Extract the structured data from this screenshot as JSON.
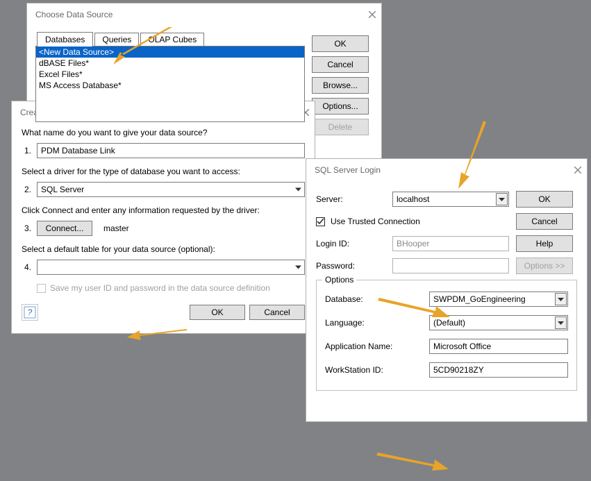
{
  "cds": {
    "title": "Choose Data Source",
    "tabs": [
      "Databases",
      "Queries",
      "OLAP Cubes"
    ],
    "list_items": [
      "<New Data Source>",
      "dBASE Files*",
      "Excel Files*",
      "MS Access Database*"
    ],
    "buttons": {
      "ok": "OK",
      "cancel": "Cancel",
      "browse": "Browse...",
      "options": "Options...",
      "delete": "Delete"
    }
  },
  "cnds": {
    "title": "Create New Data Source",
    "q1": "What name do you want to give your data source?",
    "q2": "Select a driver for the type of database you want to access:",
    "q3": "Click Connect and enter any information requested by the driver:",
    "q4": "Select a default table for your data source (optional):",
    "row_nums": {
      "1": "1.",
      "2": "2.",
      "3": "3.",
      "4": "4."
    },
    "name_value": "PDM Database Link",
    "driver_value": "SQL Server",
    "connect_label": "Connect...",
    "connected_db": "master",
    "save_creds_label": "Save my user ID and password in the data source definition",
    "help_glyph": "❓",
    "ok": "OK",
    "cancel": "Cancel"
  },
  "sql": {
    "title": "SQL Server Login",
    "labels": {
      "server": "Server:",
      "trusted": "Use Trusted Connection",
      "login": "Login ID:",
      "password": "Password:",
      "options_legend": "Options",
      "database": "Database:",
      "language": "Language:",
      "appname": "Application Name:",
      "workstation": "WorkStation ID:"
    },
    "values": {
      "server": "localhost",
      "login": "BHooper",
      "password": "",
      "database": "SWPDM_GoEngineering",
      "language": "(Default)",
      "appname": "Microsoft Office",
      "workstation": "5CD90218ZY"
    },
    "buttons": {
      "ok": "OK",
      "cancel": "Cancel",
      "help": "Help",
      "options": "Options >>"
    }
  }
}
